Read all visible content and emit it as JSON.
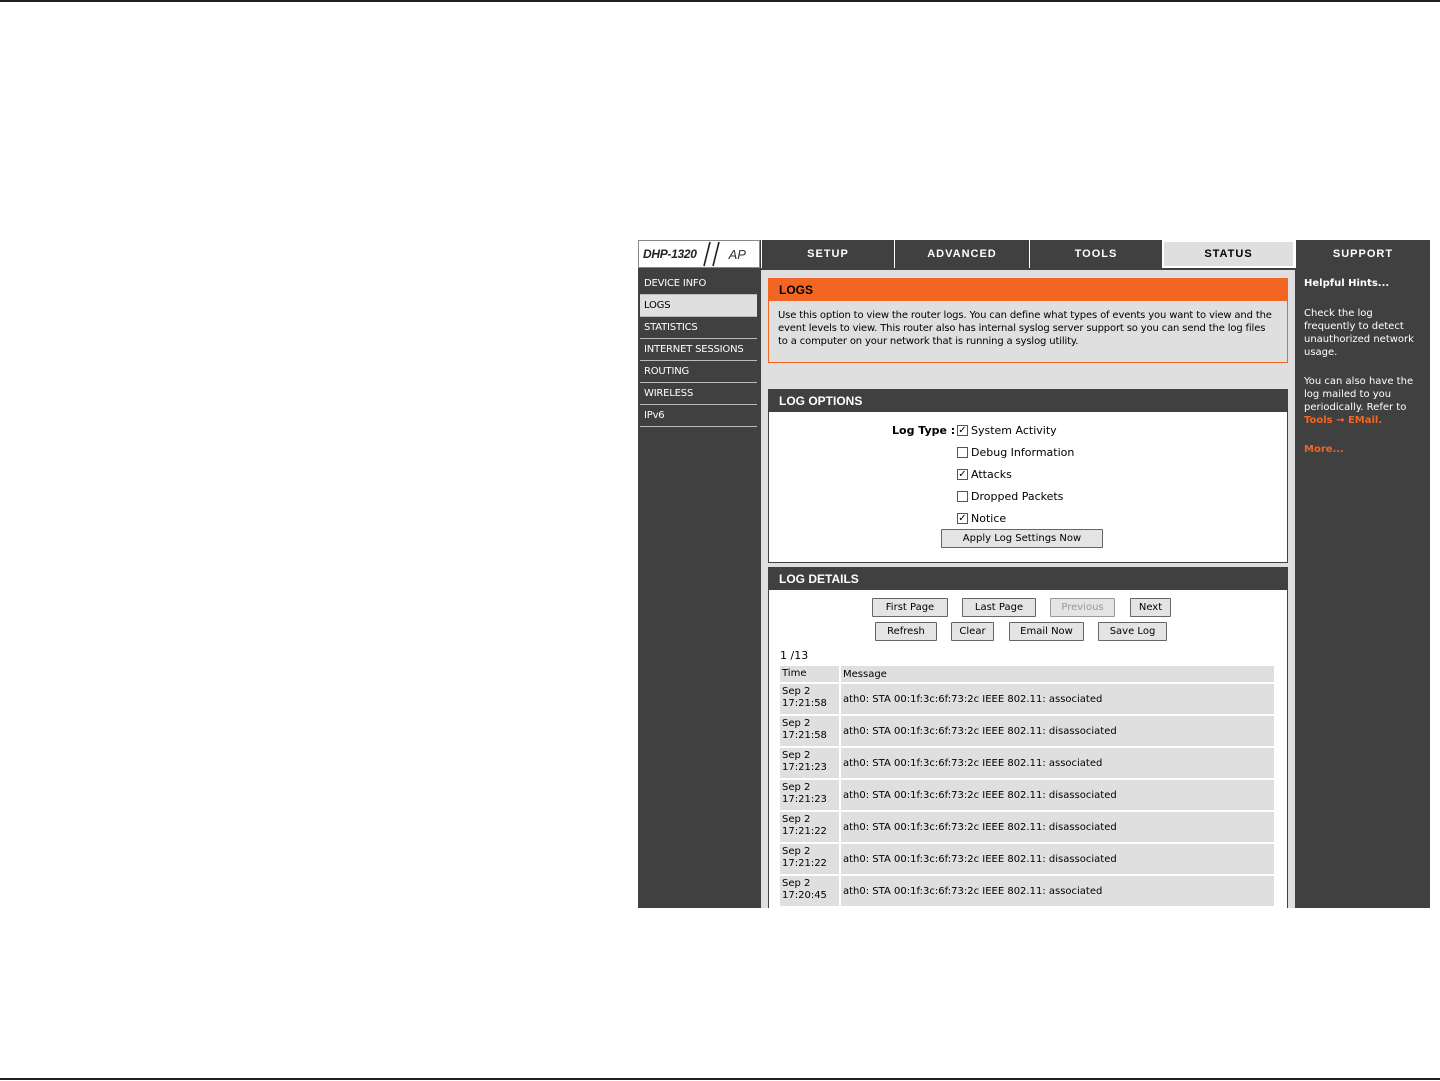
{
  "header": {
    "logo_model": "DHP-1320",
    "logo_suffix": "AP",
    "tabs": [
      {
        "label": "SETUP"
      },
      {
        "label": "ADVANCED"
      },
      {
        "label": "TOOLS"
      },
      {
        "label": "STATUS"
      },
      {
        "label": "SUPPORT"
      }
    ],
    "active_tab": "STATUS"
  },
  "sidebar": {
    "items": [
      {
        "label": "DEVICE INFO"
      },
      {
        "label": "LOGS"
      },
      {
        "label": "STATISTICS"
      },
      {
        "label": "INTERNET SESSIONS"
      },
      {
        "label": "ROUTING"
      },
      {
        "label": "WIRELESS"
      },
      {
        "label": "IPv6"
      }
    ],
    "active_item": "LOGS"
  },
  "logs_section": {
    "title": "LOGS",
    "description": "Use this option to view the router logs. You can define what types of events you want to view and the event levels to view. This router also has internal syslog server support so you can send the log files to a computer on your network that is running a syslog utility."
  },
  "log_options": {
    "title": "LOG OPTIONS",
    "log_type_label": "Log Type :",
    "options": [
      {
        "label": "System Activity",
        "checked": true
      },
      {
        "label": "Debug Information",
        "checked": false
      },
      {
        "label": "Attacks",
        "checked": true
      },
      {
        "label": "Dropped Packets",
        "checked": false
      },
      {
        "label": "Notice",
        "checked": true
      }
    ],
    "apply_label": "Apply Log Settings Now"
  },
  "log_details": {
    "title": "LOG DETAILS",
    "buttons": {
      "first_page": "First Page",
      "last_page": "Last Page",
      "previous": "Previous",
      "next": "Next",
      "refresh": "Refresh",
      "clear": "Clear",
      "email_now": "Email Now",
      "save_log": "Save Log"
    },
    "page_counter": "1 /13",
    "columns": {
      "time": "Time",
      "message": "Message"
    },
    "rows": [
      {
        "date": "Sep 2",
        "time": "17:21:58",
        "message": "ath0: STA 00:1f:3c:6f:73:2c IEEE 802.11: associated"
      },
      {
        "date": "Sep 2",
        "time": "17:21:58",
        "message": "ath0: STA 00:1f:3c:6f:73:2c IEEE 802.11: disassociated"
      },
      {
        "date": "Sep 2",
        "time": "17:21:23",
        "message": "ath0: STA 00:1f:3c:6f:73:2c IEEE 802.11: associated"
      },
      {
        "date": "Sep 2",
        "time": "17:21:23",
        "message": "ath0: STA 00:1f:3c:6f:73:2c IEEE 802.11: disassociated"
      },
      {
        "date": "Sep 2",
        "time": "17:21:22",
        "message": "ath0: STA 00:1f:3c:6f:73:2c IEEE 802.11: disassociated"
      },
      {
        "date": "Sep 2",
        "time": "17:21:22",
        "message": "ath0: STA 00:1f:3c:6f:73:2c IEEE 802.11: disassociated"
      },
      {
        "date": "Sep 2",
        "time": "17:20:45",
        "message": "ath0: STA 00:1f:3c:6f:73:2c IEEE 802.11: associated"
      }
    ]
  },
  "hints": {
    "title": "Helpful Hints...",
    "hint1": "Check the log frequently to detect unauthorized network usage.",
    "hint2_text": "You can also have the log mailed to you periodically. Refer to",
    "hint2_link": "Tools → EMail.",
    "more": "More..."
  },
  "colors": {
    "dark": "#404040",
    "panel": "#dfdfdf",
    "accent": "#f26522"
  },
  "icons": {
    "checkbox_checked": "check-mark",
    "logo_mark": "double-slash"
  }
}
